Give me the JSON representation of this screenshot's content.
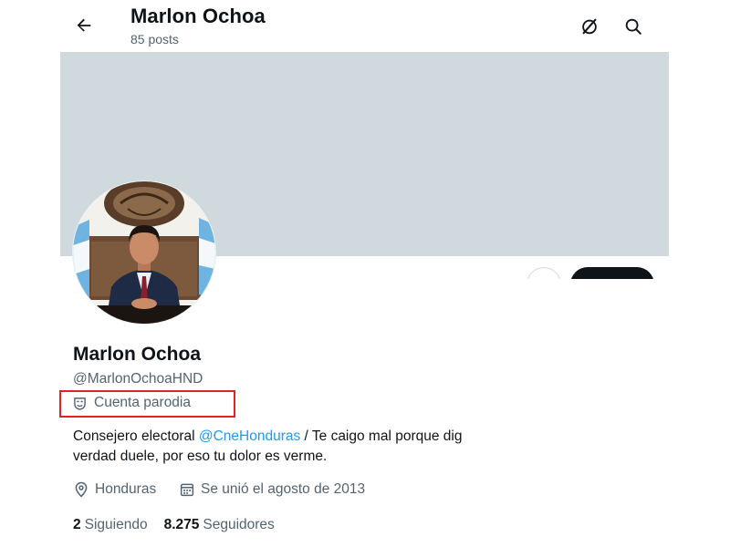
{
  "header": {
    "display_name": "Marlon Ochoa",
    "posts_count": "85 posts"
  },
  "profile": {
    "display_name": "Marlon Ochoa",
    "handle": "@MarlonOchoaHND",
    "parody_label": "Cuenta parodia",
    "bio_part1": "Consejero electoral ",
    "bio_mention": "@CneHonduras",
    "bio_part2": " / Te caigo mal porque dig",
    "bio_line2": "verdad duele, por eso tu dolor es verme.",
    "location": "Honduras",
    "joined": "Se unió el agosto de 2013"
  },
  "stats": {
    "following_count": "2",
    "following_label": "Siguiendo",
    "followers_count": "8.275",
    "followers_label": "Seguidores"
  },
  "icons": {
    "back": "back-arrow-icon",
    "grok": "grok-icon",
    "search": "search-icon",
    "parody": "parody-mask-icon",
    "location": "location-pin-icon",
    "calendar": "calendar-icon"
  },
  "colors": {
    "banner": "#cfd9de",
    "secondary_text": "#536471",
    "link": "#1d9bf0",
    "highlight_box": "#e0232a",
    "primary_text": "#0f1419"
  }
}
